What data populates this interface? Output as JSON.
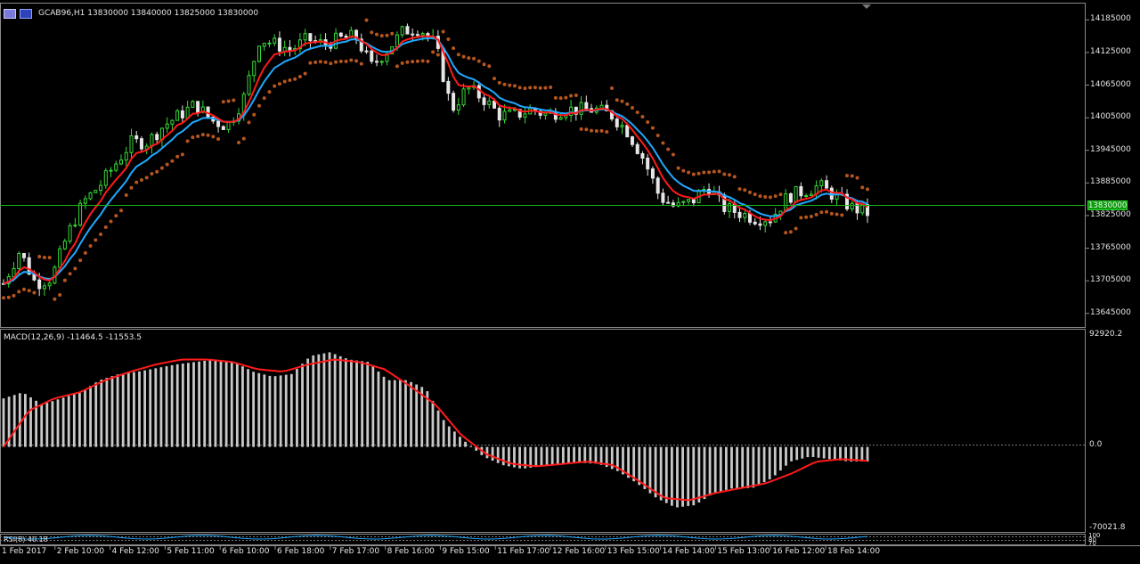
{
  "header": {
    "symbol_line": "GCAB96,H1  13830000 13840000 13825000 13830000",
    "icon_1": "chart-window-icon",
    "icon_2": "chart-flag-icon"
  },
  "price_axis": {
    "ticks": [
      "14185000",
      "14125000",
      "14065000",
      "14005000",
      "13945000",
      "13885000",
      "13825000",
      "13765000",
      "13705000",
      "13645000"
    ],
    "current_price": "13830000"
  },
  "macd_panel": {
    "title": "MACD(12,26,9) -11464.5 -11553.5",
    "ticks": [
      "92920.2",
      "0.0",
      "-70021.8"
    ]
  },
  "rsi_panel": {
    "title": "RSI(8) 40.18",
    "ticks": [
      "100",
      "80",
      "70"
    ]
  },
  "time_axis": {
    "labels": [
      "1 Feb 2017",
      "2 Feb 10:00",
      "4 Feb 12:00",
      "5 Feb 11:00",
      "6 Feb 10:00",
      "6 Feb 18:00",
      "7 Feb 17:00",
      "8 Feb 16:00",
      "9 Feb 15:00",
      "11 Feb 17:00",
      "12 Feb 16:00",
      "13 Feb 15:00",
      "14 Feb 14:00",
      "15 Feb 13:00",
      "16 Feb 12:00",
      "18 Feb 14:00"
    ]
  },
  "colors": {
    "background": "#000000",
    "candle_up": "#36d936",
    "candle_body_up": "#000000",
    "candle_down": "#e6e6e6",
    "ma_fast": "#ff1a1a",
    "ma_slow": "#1fa9ff",
    "sar": "#b5561f",
    "current_price_line": "#17b817",
    "macd_hist": "#c8c8c8",
    "macd_signal": "#ff1a1a"
  },
  "chart_data": {
    "type": "candlestick",
    "timeframe": "H1",
    "x_start": "1 Feb 2017",
    "x_end": "18 Feb 14:00",
    "ylim": [
      13620000,
      14215000
    ],
    "y_ticks": [
      14185000,
      14125000,
      14065000,
      14005000,
      13945000,
      13885000,
      13825000,
      13765000,
      13705000,
      13645000
    ],
    "last": {
      "open": 13830000,
      "high": 13840000,
      "low": 13825000,
      "close": 13830000
    },
    "price_path": [
      13700000,
      13760000,
      13700000,
      13710000,
      13790000,
      13850000,
      13880000,
      13920000,
      13960000,
      13960000,
      13990000,
      14010000,
      14030000,
      14000000,
      13990000,
      14040000,
      14150000,
      14140000,
      14130000,
      14150000,
      14140000,
      14150000,
      14155000,
      14100000,
      14130000,
      14165000,
      14170000,
      14140000,
      14020000,
      14060000,
      14040000,
      14010000,
      14010000,
      14020000,
      14010000,
      14020000,
      14020000,
      14020000,
      14010000,
      13980000,
      13930000,
      13860000,
      13840000,
      13850000,
      13880000,
      13840000,
      13830000,
      13820000,
      13820000,
      13860000,
      13870000,
      13880000,
      13860000,
      13840000,
      13830000
    ],
    "macd_ylim": [
      -70021.8,
      92920.2
    ],
    "macd_hist_path": [
      40000,
      45000,
      35000,
      40000,
      45000,
      55000,
      60000,
      62000,
      65000,
      68000,
      70000,
      72000,
      70000,
      62000,
      58000,
      60000,
      75000,
      78000,
      72000,
      70000,
      55000,
      55000,
      48000,
      20000,
      5000,
      -8000,
      -15000,
      -18000,
      -16000,
      -14000,
      -13000,
      -14000,
      -20000,
      -30000,
      -42000,
      -50000,
      -48000,
      -38000,
      -34000,
      -34000,
      -26000,
      -12000,
      -8000,
      -10000,
      -12000,
      -12000
    ],
    "macd_signal_path": [
      0,
      30000,
      40000,
      45000,
      55000,
      62000,
      68000,
      72000,
      72000,
      70000,
      64000,
      62000,
      68000,
      72000,
      70000,
      64000,
      50000,
      35000,
      10000,
      -6000,
      -14000,
      -16000,
      -14000,
      -12000,
      -15000,
      -28000,
      -42000,
      -44000,
      -38000,
      -34000,
      -30000,
      -22000,
      -12000,
      -10000,
      -11500
    ]
  }
}
